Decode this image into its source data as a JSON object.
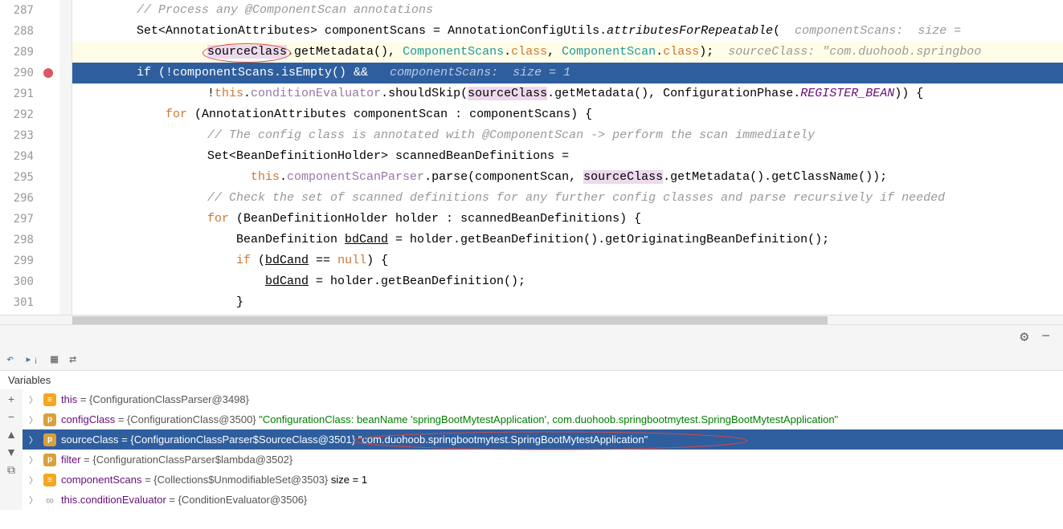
{
  "gutter": [
    "287",
    "288",
    "289",
    "290",
    "291",
    "292",
    "293",
    "294",
    "295",
    "296",
    "297",
    "298",
    "299",
    "300",
    "301"
  ],
  "code": {
    "l287": "// Process any @ComponentScan annotations",
    "l288_a": "Set<AnnotationAttributes> componentScans = AnnotationConfigUtils.",
    "l288_b": "attributesForRepeatable",
    "l288_c": "(",
    "l288_hint": "  componentScans:  size =",
    "l289_a": "sourceClass",
    "l289_b": ".getMetadata(), ",
    "l289_c": "ComponentScans",
    "l289_d": ".",
    "l289_e": "class",
    "l289_f": ", ",
    "l289_g": "ComponentScan",
    "l289_h": ".",
    "l289_i": "class",
    "l289_j": ");",
    "l289_hint": "  sourceClass: \"com.duohoob.springboo",
    "l290_a": "if",
    "l290_b": " (!componentScans.isEmpty() &&",
    "l290_hint": "   componentScans:  size = 1",
    "l291_a": "!",
    "l291_b": "this",
    "l291_c": ".",
    "l291_d": "conditionEvaluator",
    "l291_e": ".shouldSkip(",
    "l291_f": "sourceClass",
    "l291_g": ".getMetadata(), ConfigurationPhase.",
    "l291_h": "REGISTER_BEAN",
    "l291_i": ")) {",
    "l292_a": "for",
    "l292_b": " (AnnotationAttributes componentScan : componentScans) {",
    "l293": "// The config class is annotated with @ComponentScan -> perform the scan immediately",
    "l294": "Set<BeanDefinitionHolder> scannedBeanDefinitions =",
    "l295_a": "this",
    "l295_b": ".",
    "l295_c": "componentScanParser",
    "l295_d": ".parse(componentScan, ",
    "l295_e": "sourceClass",
    "l295_f": ".getMetadata().getClassName());",
    "l296": "// Check the set of scanned definitions for any further config classes and parse recursively if needed",
    "l297_a": "for",
    "l297_b": " (BeanDefinitionHolder holder : scannedBeanDefinitions) {",
    "l298_a": "BeanDefinition ",
    "l298_b": "bdCand",
    "l298_c": " = holder.getBeanDefinition().getOriginatingBeanDefinition();",
    "l299_a": "if",
    "l299_b": " (",
    "l299_c": "bdCand",
    "l299_d": " == ",
    "l299_e": "null",
    "l299_f": ") {",
    "l300_a": "bdCand",
    "l300_b": " = holder.getBeanDefinition();",
    "l301": "}"
  },
  "variables": {
    "label": "Variables",
    "rows": [
      {
        "icon": "orange",
        "iconTxt": "≡",
        "name": "this",
        "val": " = {ConfigurationClassParser@3498}",
        "str": ""
      },
      {
        "icon": "yellow",
        "iconTxt": "p",
        "name": "configClass",
        "val": " = {ConfigurationClass@3500} ",
        "str": "\"ConfigurationClass: beanName 'springBootMytestApplication', com.duohoob.springbootmytest.SpringBootMytestApplication\""
      },
      {
        "icon": "yellow",
        "iconTxt": "p",
        "name": "sourceClass",
        "val": " = {ConfigurationClassParser$SourceClass@3501} ",
        "str": "\"com.duohoob.springbootmytest.SpringBootMytestApplication\""
      },
      {
        "icon": "yellow",
        "iconTxt": "p",
        "name": "filter",
        "val": " = {ConfigurationClassParser$lambda@3502}",
        "str": ""
      },
      {
        "icon": "orange",
        "iconTxt": "≡",
        "name": "componentScans",
        "val": " = {Collections$UnmodifiableSet@3503} ",
        "str": " size = 1"
      },
      {
        "icon": "gray",
        "iconTxt": "∞",
        "name": "this.conditionEvaluator",
        "val": " = {ConditionEvaluator@3506}",
        "str": ""
      }
    ]
  }
}
